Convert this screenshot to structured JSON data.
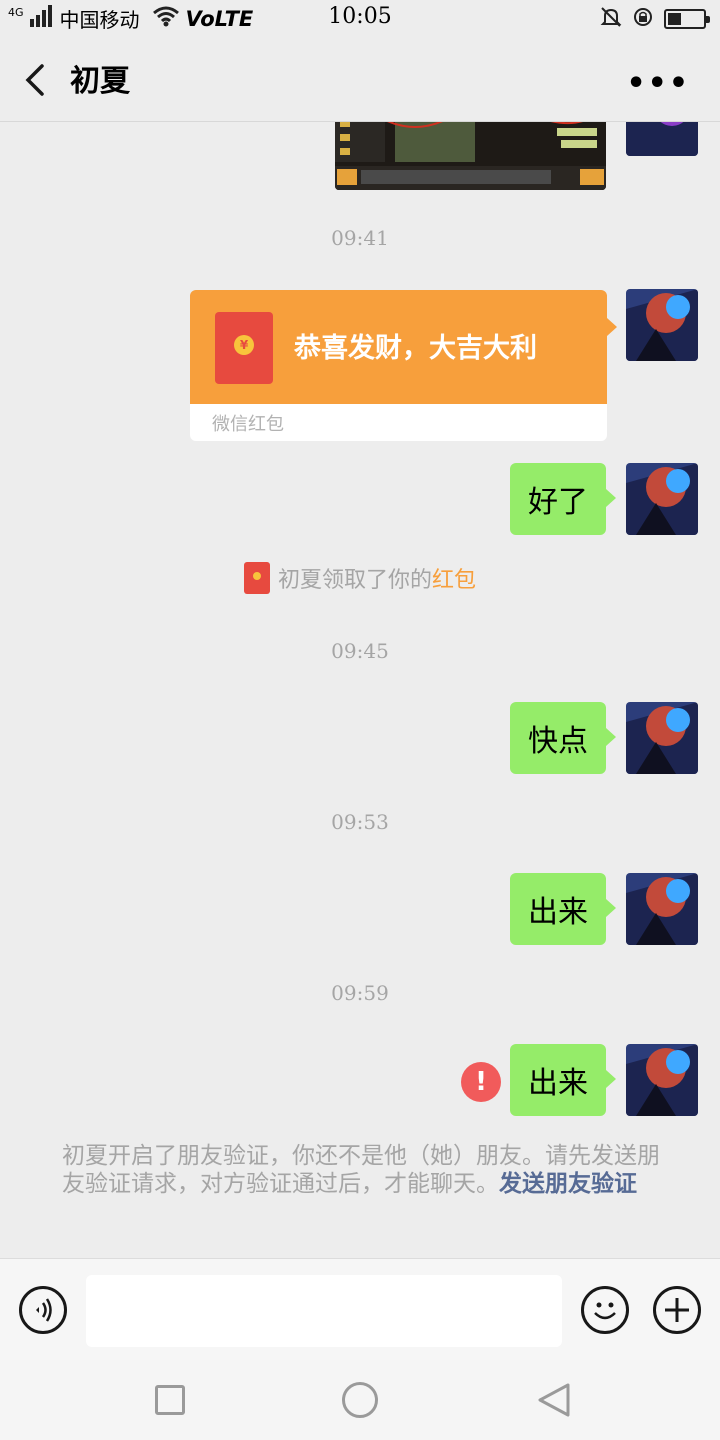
{
  "status_bar": {
    "network": "4G",
    "carrier": "中国移动",
    "volte": "VoLTE",
    "time": "10:05"
  },
  "header": {
    "title": "初夏",
    "back_icon": "chevron-left-icon",
    "more_icon": "more-dots-icon",
    "more_label": "•••"
  },
  "messages": [
    {
      "type": "image",
      "from": "friend_screenshot"
    },
    {
      "type": "timestamp",
      "text": "09:41"
    },
    {
      "type": "red_packet",
      "title": "恭喜发财，大吉大利",
      "label": "微信红包",
      "coin": "¥"
    },
    {
      "type": "text",
      "text": "好了"
    },
    {
      "type": "system",
      "prefix": "初夏领取了你的",
      "highlight": "红包"
    },
    {
      "type": "timestamp",
      "text": "09:45"
    },
    {
      "type": "text",
      "text": "快点"
    },
    {
      "type": "timestamp",
      "text": "09:53"
    },
    {
      "type": "text",
      "text": "出来"
    },
    {
      "type": "timestamp",
      "text": "09:59"
    },
    {
      "type": "text",
      "text": "出来",
      "failed": true,
      "error_mark": "!"
    }
  ],
  "notice": {
    "text": "初夏开启了朋友验证，你还不是他（她）朋友。请先发送朋友验证请求，对方验证通过后，才能聊天。",
    "link": "发送朋友验证"
  },
  "input_bar": {
    "voice_icon": "voice-icon",
    "emoji_icon": "emoji-icon",
    "plus_icon": "plus-icon",
    "input_value": ""
  },
  "colors": {
    "bubble_green": "#95ec69",
    "red_packet_orange": "#f79f3c",
    "link_blue": "#576b95",
    "error_red": "#f15b5b"
  }
}
